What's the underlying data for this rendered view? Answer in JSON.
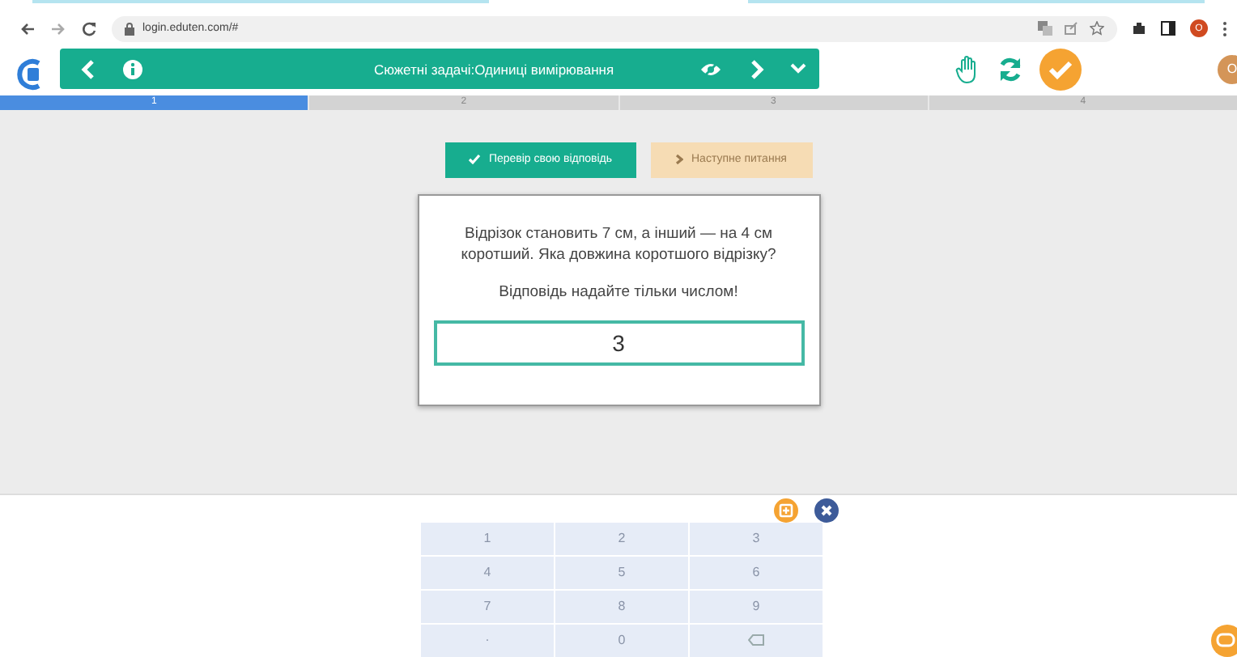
{
  "browser": {
    "url": "login.eduten.com/#",
    "profile": "O"
  },
  "header": {
    "title": "Сюжетні задачі:Одиниці вимірювання",
    "avatar": "O"
  },
  "steps": [
    {
      "label": "1",
      "selected": true
    },
    {
      "label": "2",
      "selected": false
    },
    {
      "label": "3",
      "selected": false
    },
    {
      "label": "4",
      "selected": false
    }
  ],
  "actions": [
    {
      "label": "Перевір свою відповідь",
      "disabled": false
    },
    {
      "label": "Наступне питання",
      "disabled": true
    }
  ],
  "question": {
    "text": "Відрізок становить 7 см, а інший — на 4 см коротший. Яка довжина коротшого відрізку?",
    "instruction": "Відповідь надайте тільки числом!",
    "answer": "3"
  },
  "keypad": [
    {
      "kind": "key",
      "label": "1"
    },
    {
      "kind": "key",
      "label": "2"
    },
    {
      "kind": "key",
      "label": "3"
    },
    {
      "kind": "key",
      "label": "4"
    },
    {
      "kind": "key",
      "label": "5"
    },
    {
      "kind": "key",
      "label": "6"
    },
    {
      "kind": "key",
      "label": "7"
    },
    {
      "kind": "key",
      "label": "8"
    },
    {
      "kind": "key",
      "label": "9"
    },
    {
      "kind": "key",
      "label": "."
    },
    {
      "kind": "key",
      "label": "0"
    },
    {
      "kind": "backspace"
    }
  ]
}
